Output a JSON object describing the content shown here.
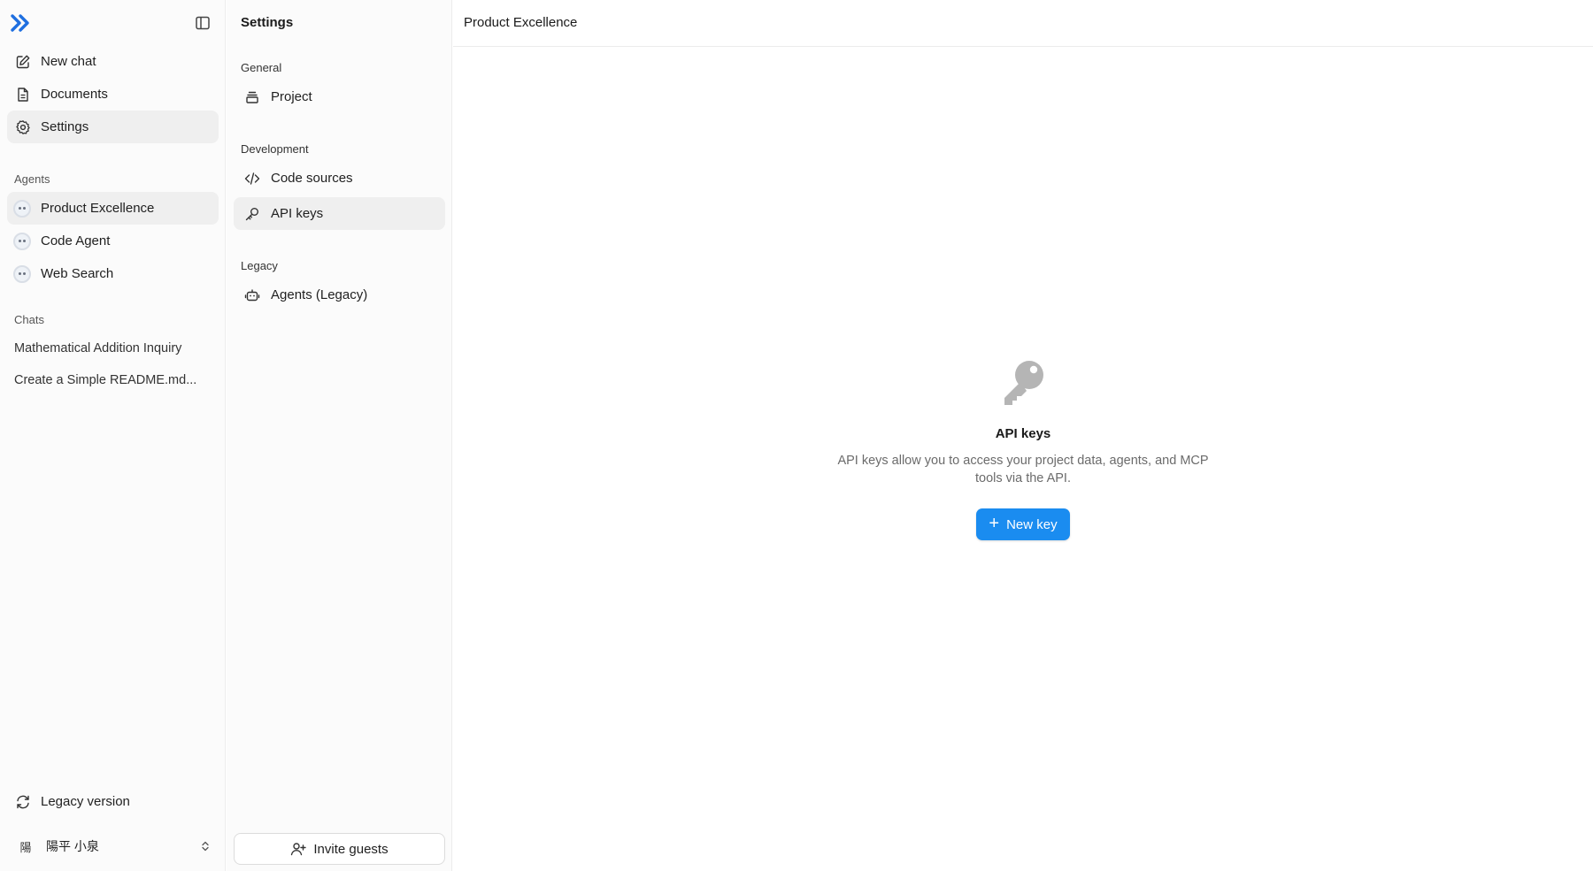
{
  "colors": {
    "accent": "#1a8cf0",
    "logo": "#1f6fe0",
    "active_bg": "#efefef"
  },
  "sidebar": {
    "nav": [
      {
        "label": "New chat",
        "icon": "edit-icon"
      },
      {
        "label": "Documents",
        "icon": "document-icon"
      },
      {
        "label": "Settings",
        "icon": "gear-icon"
      }
    ],
    "agents_label": "Agents",
    "agents": [
      {
        "label": "Product Excellence"
      },
      {
        "label": "Code Agent"
      },
      {
        "label": "Web Search"
      }
    ],
    "chats_label": "Chats",
    "chats": [
      {
        "label": "Mathematical Addition Inquiry"
      },
      {
        "label": "Create a Simple README.md..."
      }
    ],
    "legacy_version": "Legacy version",
    "user": {
      "initial": "陽",
      "name": "陽平 小泉"
    }
  },
  "settings": {
    "title": "Settings",
    "general_label": "General",
    "project": "Project",
    "development_label": "Development",
    "code_sources": "Code sources",
    "api_keys": "API keys",
    "legacy_label": "Legacy",
    "agents_legacy": "Agents (Legacy)",
    "invite": "Invite guests"
  },
  "main": {
    "title": "Product Excellence",
    "empty_title": "API keys",
    "empty_desc": "API keys allow you to access your project data, agents, and MCP tools via the API.",
    "new_key": "New key"
  }
}
